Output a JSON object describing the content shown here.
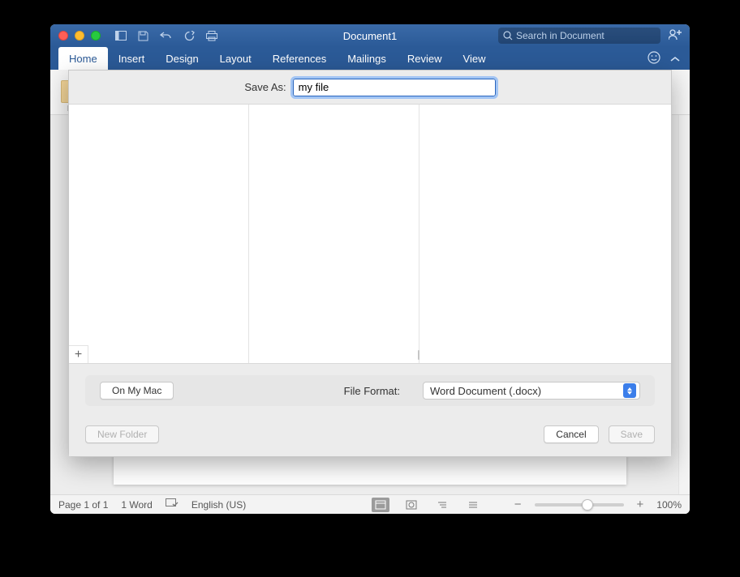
{
  "window": {
    "title": "Document1"
  },
  "search": {
    "placeholder": "Search in Document"
  },
  "ribbon": {
    "tabs": [
      "Home",
      "Insert",
      "Design",
      "Layout",
      "References",
      "Mailings",
      "Review",
      "View"
    ],
    "active_index": 0,
    "group_label": "Pa"
  },
  "dialog": {
    "save_as_label": "Save As:",
    "filename": "my file",
    "on_my_mac": "On My Mac",
    "file_format_label": "File Format:",
    "file_format_value": "Word Document (.docx)",
    "new_folder": "New Folder",
    "cancel": "Cancel",
    "save": "Save",
    "plus": "+"
  },
  "status": {
    "page": "Page 1 of 1",
    "words": "1 Word",
    "language": "English (US)",
    "zoom": "100%",
    "minus": "−",
    "plusz": "+"
  }
}
